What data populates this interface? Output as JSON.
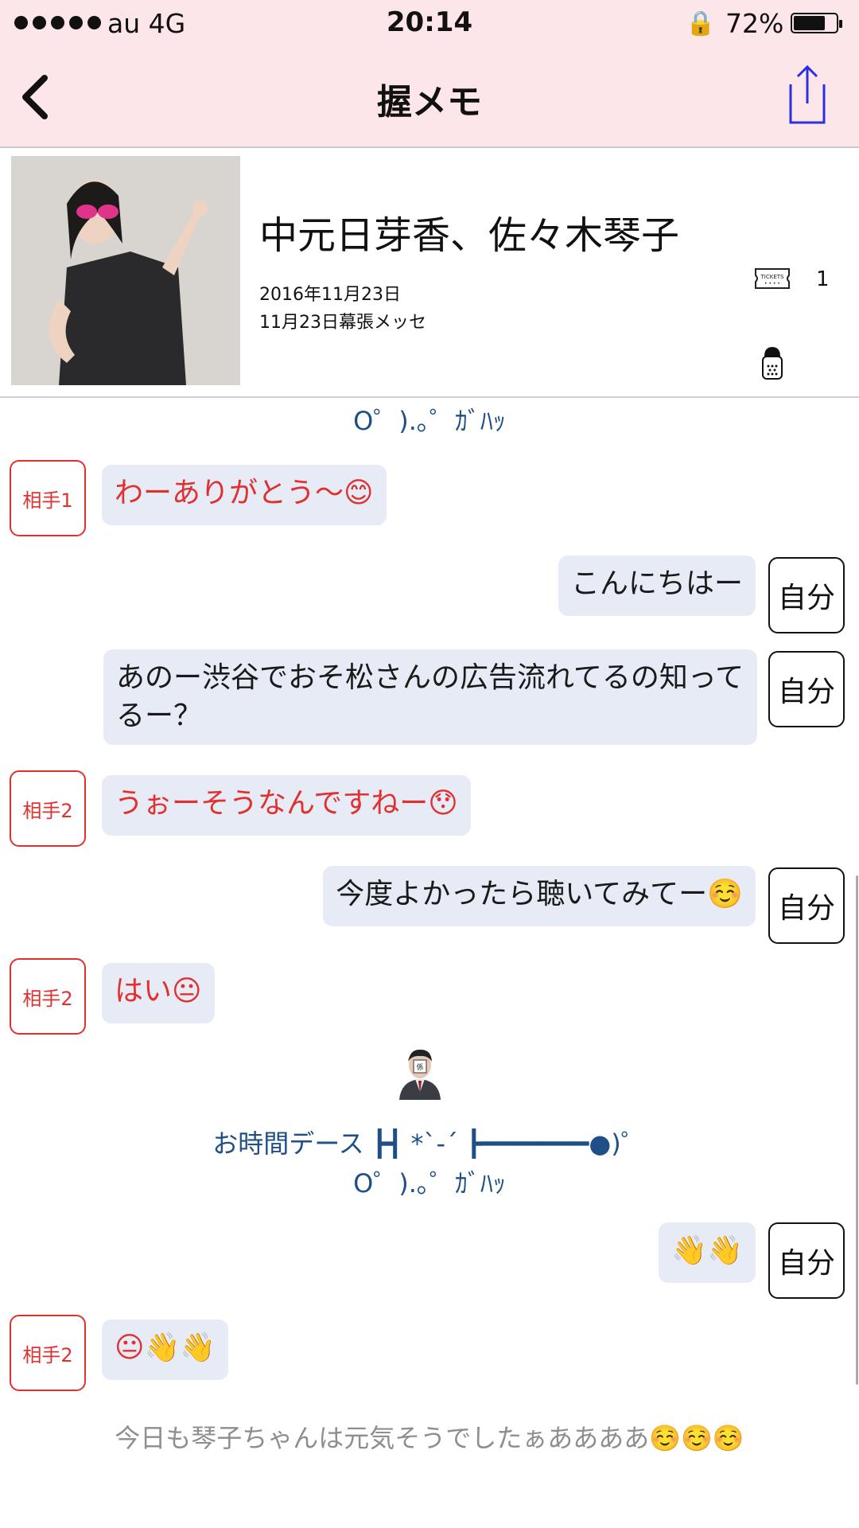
{
  "status_bar": {
    "carrier": "au   4G",
    "time": "20:14",
    "battery": "72%",
    "battery_level": 0.72
  },
  "nav": {
    "title": "握メモ",
    "back_icon": "chevron-left-icon",
    "share_icon": "share-icon"
  },
  "header": {
    "member": "中元日芽香、佐々木琴子",
    "date": "2016年11月23日",
    "venue": "11月23日幕張メッセ",
    "ticket_count": "1",
    "ticket_label": "TICKETS"
  },
  "messages": {
    "kaomoji_top": "O゜).｡゜ｶﾞﾊｯ",
    "m1": {
      "speaker": "相手1",
      "text": "わーありがとう〜😊"
    },
    "m2": {
      "speaker": "自分",
      "text": "こんにちはー"
    },
    "m3": {
      "speaker": "自分",
      "text": "あのー渋谷でおそ松さんの広告流れてるの知ってるー？"
    },
    "m4": {
      "speaker": "相手2",
      "text": "うぉーそうなんですねー😯"
    },
    "m5": {
      "speaker": "自分",
      "text": "今度よかったら聴いてみてー☺️"
    },
    "m6": {
      "speaker": "相手2",
      "text": "はい😐"
    },
    "time_up": "お時間デース ┣┫ *`-´ ┣━━━━━━━●)゜",
    "kaomoji_bottom": "O゜).｡゜ｶﾞﾊｯ",
    "m7": {
      "speaker": "自分",
      "text": "👋👋"
    },
    "m8": {
      "speaker": "相手2",
      "text": "😐👋👋"
    },
    "note": "今日も琴子ちゃんは元気そうでしたぁああああ☺️☺️☺️"
  },
  "colors": {
    "nav_bg": "#fde6e9",
    "partner": "#e03030",
    "bubble": "#e7ebf5",
    "kaomoji": "#1e4f86",
    "share": "#2a30e0"
  }
}
